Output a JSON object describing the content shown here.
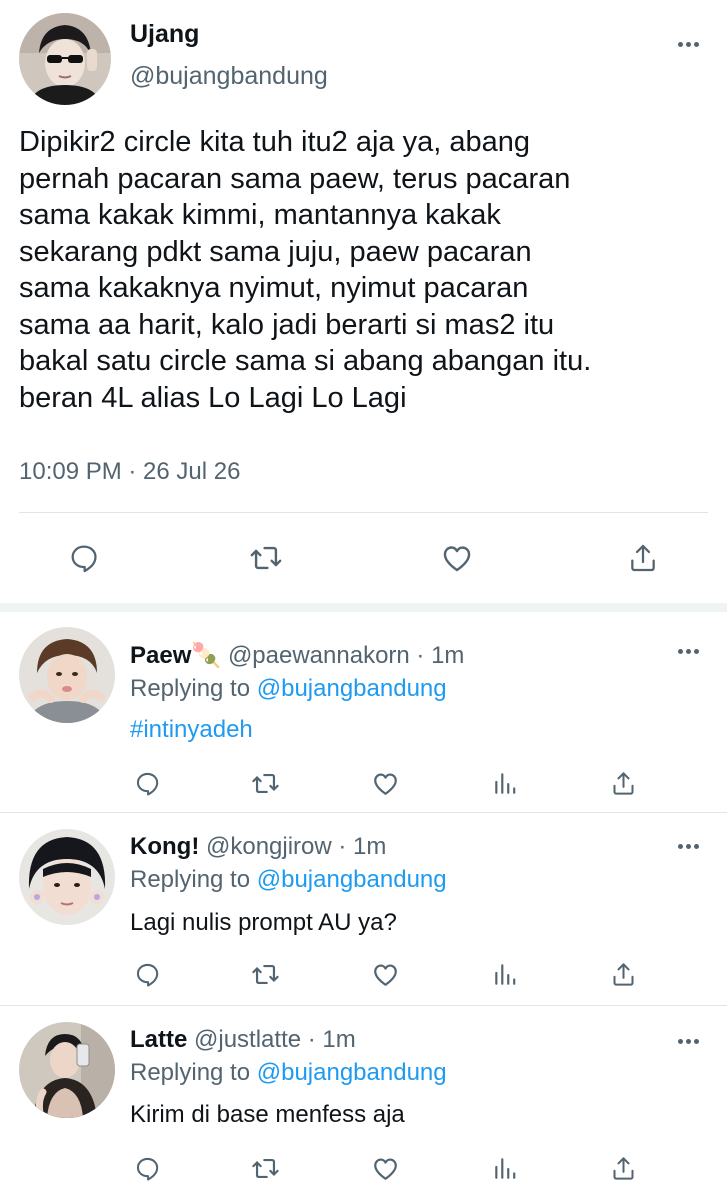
{
  "main_tweet": {
    "name": "Ujang",
    "handle": "@bujangbandung",
    "text": "Dipikir2 circle kita tuh itu2 aja ya, abang\npernah pacaran sama paew, terus pacaran\nsama kakak kimmi, mantannya kakak\nsekarang pdkt sama juju, paew pacaran\nsama kakaknya nyimut, nyimut pacaran\nsama aa harit, kalo jadi berarti si mas2 itu\nbakal satu circle sama si abang abangan itu.\nberan 4L alias Lo Lagi Lo Lagi",
    "timestamp": "10:09 PM · 26 Jul 26",
    "actions": [
      "reply-icon",
      "retweet-icon",
      "like-icon",
      "share-icon"
    ]
  },
  "replies": [
    {
      "name": "Paew",
      "name_emoji": "🍡",
      "handle_time": "@paewannakorn · 1m",
      "replying_prefix": "Replying to",
      "replying_to": "@bujangbandung",
      "text": "#intinyadeh",
      "text_is_hashtag": true
    },
    {
      "name": "Kong!",
      "name_emoji": "",
      "handle_time": "@kongjirow · 1m",
      "replying_prefix": "Replying to",
      "replying_to": "@bujangbandung",
      "text": "Lagi nulis prompt AU ya?",
      "text_is_hashtag": false
    },
    {
      "name": "Latte",
      "name_emoji": "",
      "handle_time": "@justlatte · 1m",
      "replying_prefix": "Replying to",
      "replying_to": "@bujangbandung",
      "text": "Kirim di base menfess aja",
      "text_is_hashtag": false
    }
  ],
  "colors": {
    "accent": "#1d9bf0",
    "secondary_text": "#536471",
    "primary_text": "#0f1419",
    "separator": "#eff3f4"
  }
}
